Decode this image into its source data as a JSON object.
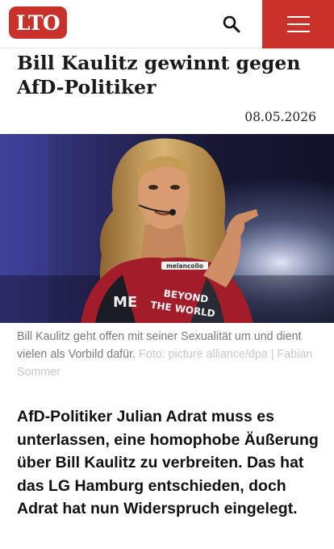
{
  "header": {
    "logo_text": "LTO",
    "brand_color": "#c8322b",
    "search_icon": "search-icon",
    "menu_icon": "hamburger-menu-icon"
  },
  "article": {
    "title": "Bill Kaulitz gewinnt gegen AfD-Politiker",
    "date": "08.05.2026",
    "image_caption": "Bill Kaulitz geht offen mit seiner Sexualität um und dient vielen als Vorbild dafür.",
    "image_credit": "Foto: picture alliance/dpa | Fabian Sommer",
    "lead": "AfD-Politiker Julian Adrat muss es unterlassen, eine homophobe Äußerung über Bill Kaulitz zu verbreiten. Das hat das LG Hamburg entschieden, doch Adrat hat nun Widerspruch eingelegt."
  },
  "photo": {
    "jacket_patch_top": "melancollo",
    "jacket_text_1": "BEYOND",
    "jacket_text_2": "THE WORLD",
    "sleeve_text": "ME"
  }
}
